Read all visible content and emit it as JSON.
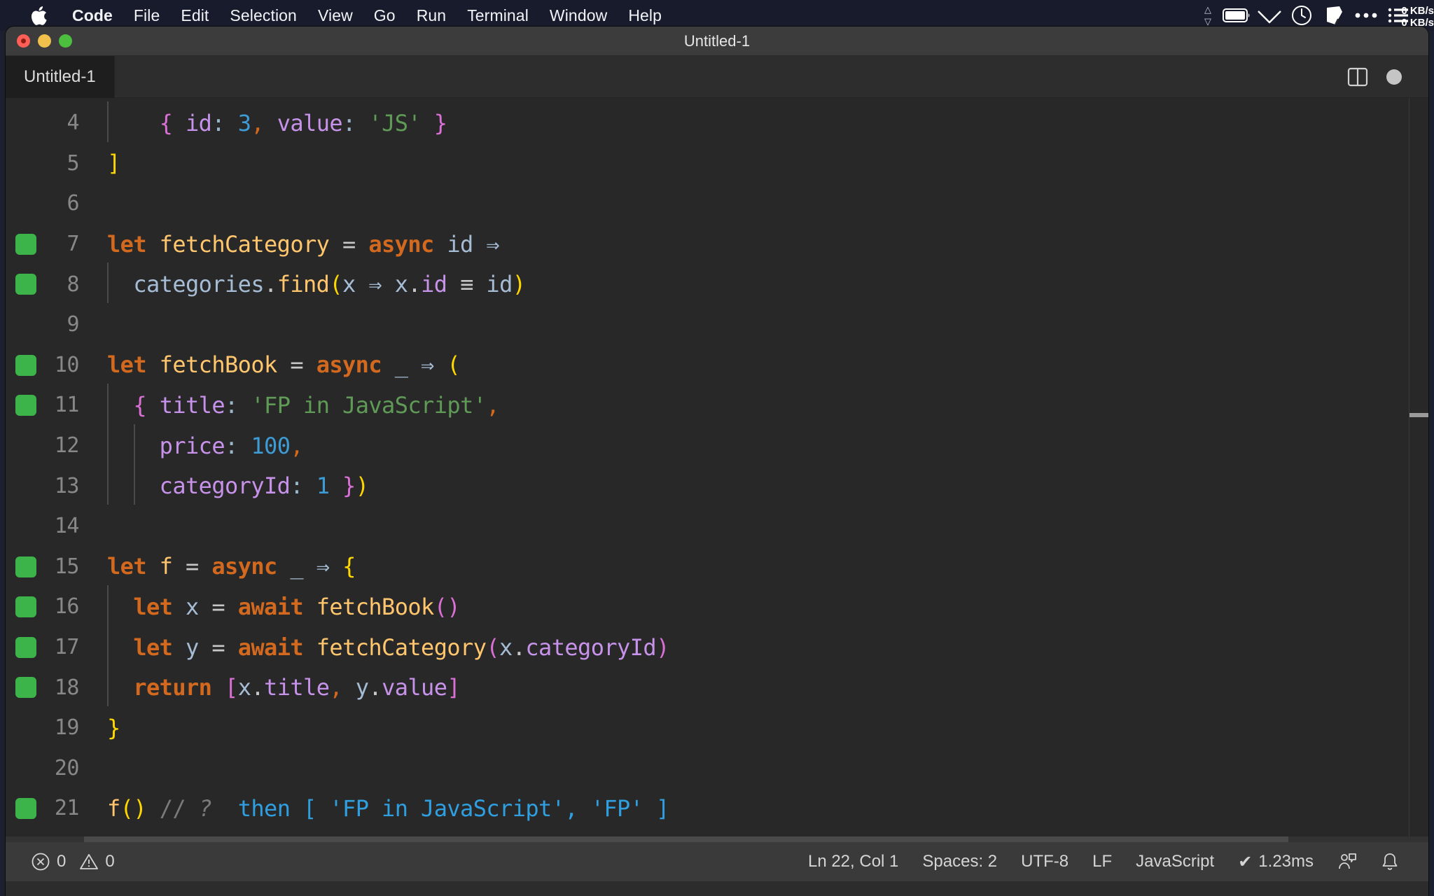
{
  "menubar": {
    "apple_icon": "apple-logo",
    "items": [
      {
        "label": "Code",
        "bold": true
      },
      {
        "label": "File",
        "bold": false
      },
      {
        "label": "Edit",
        "bold": false
      },
      {
        "label": "Selection",
        "bold": false
      },
      {
        "label": "View",
        "bold": false
      },
      {
        "label": "Go",
        "bold": false
      },
      {
        "label": "Run",
        "bold": false
      },
      {
        "label": "Terminal",
        "bold": false
      },
      {
        "label": "Window",
        "bold": false
      },
      {
        "label": "Help",
        "bold": false
      }
    ],
    "network": {
      "upload": "0 KB/s",
      "download": "0 KB/s",
      "up_arrow": "△",
      "down_arrow": "▽"
    },
    "tray": [
      "battery-icon",
      "wifi-icon",
      "clock-icon",
      "shape-icon",
      "ellipsis-icon",
      "control-center-icon"
    ]
  },
  "window": {
    "title": "Untitled-1",
    "traffic_lights": [
      "close-button",
      "minimize-button",
      "zoom-button"
    ]
  },
  "tabbar": {
    "tabs": [
      {
        "label": "Untitled-1",
        "active": true
      }
    ],
    "actions": [
      "split-editor-icon",
      "unsaved-dot-icon"
    ]
  },
  "editor": {
    "first_visible_line": 4,
    "lines": [
      {
        "num": "4",
        "breakpoint": false,
        "indent_guides": [
          0
        ],
        "tokens": [
          {
            "t": "    ",
            "c": "t-punc"
          },
          {
            "t": "{",
            "c": "t-b2"
          },
          {
            "t": " ",
            "c": "t-punc"
          },
          {
            "t": "id",
            "c": "t-prop"
          },
          {
            "t": ":",
            "c": "t-colon"
          },
          {
            "t": " ",
            "c": "t-punc"
          },
          {
            "t": "3",
            "c": "t-num"
          },
          {
            "t": ",",
            "c": "t-comma"
          },
          {
            "t": " ",
            "c": "t-punc"
          },
          {
            "t": "value",
            "c": "t-prop"
          },
          {
            "t": ":",
            "c": "t-colon"
          },
          {
            "t": " ",
            "c": "t-punc"
          },
          {
            "t": "'JS'",
            "c": "t-str"
          },
          {
            "t": " ",
            "c": "t-punc"
          },
          {
            "t": "}",
            "c": "t-b2"
          }
        ]
      },
      {
        "num": "5",
        "breakpoint": false,
        "indent_guides": [],
        "tokens": [
          {
            "t": "]",
            "c": "t-b1"
          }
        ]
      },
      {
        "num": "6",
        "breakpoint": false,
        "indent_guides": [],
        "tokens": []
      },
      {
        "num": "7",
        "breakpoint": true,
        "indent_guides": [],
        "tokens": [
          {
            "t": "let",
            "c": "t-kw"
          },
          {
            "t": " ",
            "c": "t-punc"
          },
          {
            "t": "fetchCategory",
            "c": "t-fn"
          },
          {
            "t": " ",
            "c": "t-punc"
          },
          {
            "t": "=",
            "c": "t-op"
          },
          {
            "t": " ",
            "c": "t-punc"
          },
          {
            "t": "async",
            "c": "t-kw"
          },
          {
            "t": " ",
            "c": "t-punc"
          },
          {
            "t": "id",
            "c": "t-var"
          },
          {
            "t": " ",
            "c": "t-punc"
          },
          {
            "t": "⇒",
            "c": "arrow"
          }
        ]
      },
      {
        "num": "8",
        "breakpoint": true,
        "indent_guides": [
          0
        ],
        "tokens": [
          {
            "t": "  ",
            "c": "t-punc"
          },
          {
            "t": "categories",
            "c": "t-var"
          },
          {
            "t": ".",
            "c": "t-punc"
          },
          {
            "t": "find",
            "c": "t-fn"
          },
          {
            "t": "(",
            "c": "t-b1"
          },
          {
            "t": "x",
            "c": "t-var"
          },
          {
            "t": " ",
            "c": "t-punc"
          },
          {
            "t": "⇒",
            "c": "arrow"
          },
          {
            "t": " ",
            "c": "t-punc"
          },
          {
            "t": "x",
            "c": "t-var"
          },
          {
            "t": ".",
            "c": "t-punc"
          },
          {
            "t": "id",
            "c": "t-prop"
          },
          {
            "t": " ",
            "c": "t-punc"
          },
          {
            "t": "≡",
            "c": "t-op"
          },
          {
            "t": " ",
            "c": "t-punc"
          },
          {
            "t": "id",
            "c": "t-var"
          },
          {
            "t": ")",
            "c": "t-b1"
          }
        ]
      },
      {
        "num": "9",
        "breakpoint": false,
        "indent_guides": [],
        "tokens": []
      },
      {
        "num": "10",
        "breakpoint": true,
        "indent_guides": [],
        "tokens": [
          {
            "t": "let",
            "c": "t-kw"
          },
          {
            "t": " ",
            "c": "t-punc"
          },
          {
            "t": "fetchBook",
            "c": "t-fn"
          },
          {
            "t": " ",
            "c": "t-punc"
          },
          {
            "t": "=",
            "c": "t-op"
          },
          {
            "t": " ",
            "c": "t-punc"
          },
          {
            "t": "async",
            "c": "t-kw"
          },
          {
            "t": " ",
            "c": "t-punc"
          },
          {
            "t": "_",
            "c": "t-var"
          },
          {
            "t": " ",
            "c": "t-punc"
          },
          {
            "t": "⇒",
            "c": "arrow"
          },
          {
            "t": " ",
            "c": "t-punc"
          },
          {
            "t": "(",
            "c": "t-b1"
          }
        ]
      },
      {
        "num": "11",
        "breakpoint": true,
        "indent_guides": [
          0
        ],
        "tokens": [
          {
            "t": "  ",
            "c": "t-punc"
          },
          {
            "t": "{",
            "c": "t-b2"
          },
          {
            "t": " ",
            "c": "t-punc"
          },
          {
            "t": "title",
            "c": "t-prop"
          },
          {
            "t": ":",
            "c": "t-colon"
          },
          {
            "t": " ",
            "c": "t-punc"
          },
          {
            "t": "'FP in JavaScript'",
            "c": "t-str"
          },
          {
            "t": ",",
            "c": "t-comma"
          }
        ]
      },
      {
        "num": "12",
        "breakpoint": false,
        "indent_guides": [
          0,
          1
        ],
        "tokens": [
          {
            "t": "    ",
            "c": "t-punc"
          },
          {
            "t": "price",
            "c": "t-prop"
          },
          {
            "t": ":",
            "c": "t-colon"
          },
          {
            "t": " ",
            "c": "t-punc"
          },
          {
            "t": "100",
            "c": "t-num"
          },
          {
            "t": ",",
            "c": "t-comma"
          }
        ]
      },
      {
        "num": "13",
        "breakpoint": false,
        "indent_guides": [
          0,
          1
        ],
        "tokens": [
          {
            "t": "    ",
            "c": "t-punc"
          },
          {
            "t": "categoryId",
            "c": "t-prop"
          },
          {
            "t": ":",
            "c": "t-colon"
          },
          {
            "t": " ",
            "c": "t-punc"
          },
          {
            "t": "1",
            "c": "t-num"
          },
          {
            "t": " ",
            "c": "t-punc"
          },
          {
            "t": "}",
            "c": "t-b2"
          },
          {
            "t": ")",
            "c": "t-b1"
          }
        ]
      },
      {
        "num": "14",
        "breakpoint": false,
        "indent_guides": [],
        "tokens": []
      },
      {
        "num": "15",
        "breakpoint": true,
        "indent_guides": [],
        "tokens": [
          {
            "t": "let",
            "c": "t-kw"
          },
          {
            "t": " ",
            "c": "t-punc"
          },
          {
            "t": "f",
            "c": "t-fn"
          },
          {
            "t": " ",
            "c": "t-punc"
          },
          {
            "t": "=",
            "c": "t-op"
          },
          {
            "t": " ",
            "c": "t-punc"
          },
          {
            "t": "async",
            "c": "t-kw"
          },
          {
            "t": " ",
            "c": "t-punc"
          },
          {
            "t": "_",
            "c": "t-var"
          },
          {
            "t": " ",
            "c": "t-punc"
          },
          {
            "t": "⇒",
            "c": "arrow"
          },
          {
            "t": " ",
            "c": "t-punc"
          },
          {
            "t": "{",
            "c": "t-b1"
          }
        ]
      },
      {
        "num": "16",
        "breakpoint": true,
        "indent_guides": [
          0
        ],
        "tokens": [
          {
            "t": "  ",
            "c": "t-punc"
          },
          {
            "t": "let",
            "c": "t-kw"
          },
          {
            "t": " ",
            "c": "t-punc"
          },
          {
            "t": "x",
            "c": "t-var"
          },
          {
            "t": " ",
            "c": "t-punc"
          },
          {
            "t": "=",
            "c": "t-op"
          },
          {
            "t": " ",
            "c": "t-punc"
          },
          {
            "t": "await",
            "c": "t-kw"
          },
          {
            "t": " ",
            "c": "t-punc"
          },
          {
            "t": "fetchBook",
            "c": "t-fn"
          },
          {
            "t": "()",
            "c": "t-b2"
          }
        ]
      },
      {
        "num": "17",
        "breakpoint": true,
        "indent_guides": [
          0
        ],
        "tokens": [
          {
            "t": "  ",
            "c": "t-punc"
          },
          {
            "t": "let",
            "c": "t-kw"
          },
          {
            "t": " ",
            "c": "t-punc"
          },
          {
            "t": "y",
            "c": "t-var"
          },
          {
            "t": " ",
            "c": "t-punc"
          },
          {
            "t": "=",
            "c": "t-op"
          },
          {
            "t": " ",
            "c": "t-punc"
          },
          {
            "t": "await",
            "c": "t-kw"
          },
          {
            "t": " ",
            "c": "t-punc"
          },
          {
            "t": "fetchCategory",
            "c": "t-fn"
          },
          {
            "t": "(",
            "c": "t-b2"
          },
          {
            "t": "x",
            "c": "t-var"
          },
          {
            "t": ".",
            "c": "t-punc"
          },
          {
            "t": "categoryId",
            "c": "t-prop"
          },
          {
            "t": ")",
            "c": "t-b2"
          }
        ]
      },
      {
        "num": "18",
        "breakpoint": true,
        "indent_guides": [
          0
        ],
        "tokens": [
          {
            "t": "  ",
            "c": "t-punc"
          },
          {
            "t": "return",
            "c": "t-kw"
          },
          {
            "t": " ",
            "c": "t-punc"
          },
          {
            "t": "[",
            "c": "t-b2"
          },
          {
            "t": "x",
            "c": "t-var"
          },
          {
            "t": ".",
            "c": "t-punc"
          },
          {
            "t": "title",
            "c": "t-prop"
          },
          {
            "t": ",",
            "c": "t-comma"
          },
          {
            "t": " ",
            "c": "t-punc"
          },
          {
            "t": "y",
            "c": "t-var"
          },
          {
            "t": ".",
            "c": "t-punc"
          },
          {
            "t": "value",
            "c": "t-prop"
          },
          {
            "t": "]",
            "c": "t-b2"
          }
        ]
      },
      {
        "num": "19",
        "breakpoint": false,
        "indent_guides": [],
        "tokens": [
          {
            "t": "}",
            "c": "t-b1"
          }
        ]
      },
      {
        "num": "20",
        "breakpoint": false,
        "indent_guides": [],
        "tokens": []
      },
      {
        "num": "21",
        "breakpoint": true,
        "indent_guides": [],
        "tokens": [
          {
            "t": "f",
            "c": "t-fn"
          },
          {
            "t": "()",
            "c": "t-b1"
          },
          {
            "t": " ",
            "c": "t-punc"
          },
          {
            "t": "//",
            "c": "t-com"
          },
          {
            "t": " ",
            "c": "t-punc"
          },
          {
            "t": "?",
            "c": "t-com-i"
          },
          {
            "t": "  ",
            "c": "t-punc"
          },
          {
            "t": "then [ 'FP in JavaScript', 'FP' ]",
            "c": "t-res"
          }
        ]
      }
    ]
  },
  "statusbar": {
    "errors_icon": "error-circle-icon",
    "errors": "0",
    "warnings_icon": "warning-triangle-icon",
    "warnings": "0",
    "cursor_position": "Ln 22, Col 1",
    "indentation": "Spaces: 2",
    "encoding": "UTF-8",
    "eol": "LF",
    "language": "JavaScript",
    "run_check": "✔",
    "run_time": "1.23ms",
    "feedback_icon": "feedback-person-icon",
    "notifications_icon": "bell-icon"
  },
  "colors": {
    "menubar_bg": "#171b2c",
    "titlebar_bg": "#3c3c3c",
    "editor_bg": "#282828",
    "statusbar_bg": "#3a3a3a",
    "breakpoint_green": "#3cb44a",
    "result_blue": "#2f9fe0"
  }
}
